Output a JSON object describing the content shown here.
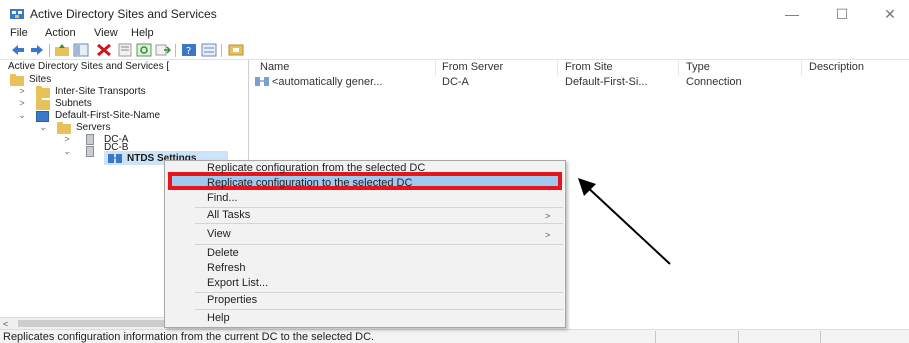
{
  "window": {
    "title": "Active Directory Sites and Services",
    "icon": "ad-sites-icon",
    "controls": {
      "minimize": "—",
      "maximize": "☐",
      "close": "✕"
    }
  },
  "menubar": {
    "items": [
      "File",
      "Action",
      "View",
      "Help"
    ]
  },
  "toolbar": {
    "buttons": [
      "back-icon",
      "forward-icon",
      "up-folder-icon",
      "show-tree-icon",
      "delete-icon",
      "properties-icon",
      "refresh-icon",
      "export-icon",
      "help-icon",
      "view-icon",
      "connection-icon"
    ]
  },
  "tree": {
    "root": "Active Directory Sites and Services [",
    "items": [
      {
        "label": "Sites",
        "icon": "folder-icon"
      },
      {
        "label": "Inter-Site Transports",
        "icon": "folder-icon",
        "expander": ">"
      },
      {
        "label": "Subnets",
        "icon": "folder-icon",
        "expander": ">"
      },
      {
        "label": "Default-First-Site-Name",
        "icon": "site-icon",
        "expander": "⌄"
      },
      {
        "label": "Servers",
        "icon": "folder-icon",
        "expander": "⌄"
      },
      {
        "label": "DC-A",
        "icon": "server-icon",
        "expander": ">"
      },
      {
        "label": "DC-B",
        "icon": "server-icon",
        "expander": "⌄"
      },
      {
        "label": "NTDS Settings",
        "icon": "ntds-settings-icon",
        "selected": true
      }
    ]
  },
  "list": {
    "columns": [
      "Name",
      "From Server",
      "From Site",
      "Type",
      "Description"
    ],
    "rows": [
      {
        "name": "<automatically gener...",
        "from_server": "DC-A",
        "from_site": "Default-First-Si...",
        "type": "Connection",
        "description": ""
      }
    ]
  },
  "context_menu": {
    "items": [
      {
        "label": "Replicate configuration from the selected DC"
      },
      {
        "label": "Replicate configuration to the selected DC",
        "highlighted": true
      },
      {
        "label": "Find..."
      },
      {
        "label": "All Tasks",
        "submenu": ">"
      },
      {
        "label": "View",
        "submenu": ">"
      },
      {
        "label": "Delete"
      },
      {
        "label": "Refresh"
      },
      {
        "label": "Export List..."
      },
      {
        "label": "Properties"
      },
      {
        "label": "Help"
      }
    ]
  },
  "statusbar": {
    "text": "Replicates configuration information from the current DC to the selected DC."
  },
  "colors": {
    "highlight_box": "#e8141b",
    "highlight_fill": "#9fc9ee",
    "annotation_arrow": "#000000",
    "selection": "#cde3f7"
  }
}
